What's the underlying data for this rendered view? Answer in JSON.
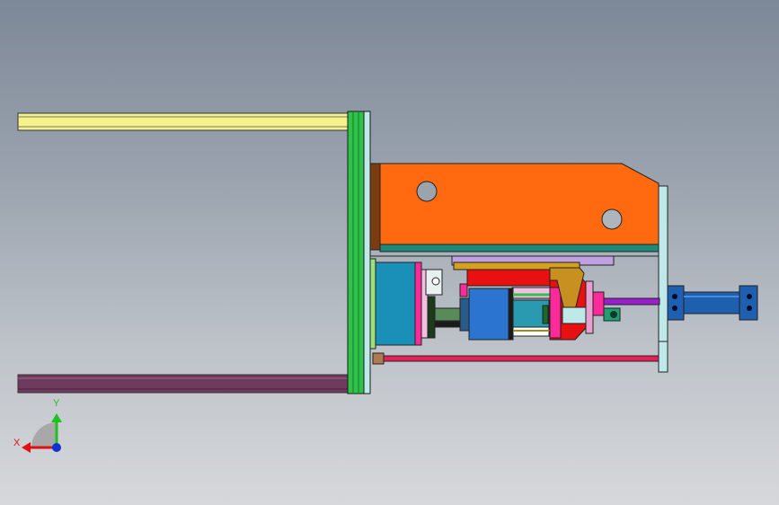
{
  "triad": {
    "x_label": "X",
    "y_label": "Y",
    "x_color": "#e01010",
    "y_color": "#20c020",
    "z_color": "#1030d0"
  },
  "colors": {
    "background_top": "#7d8898",
    "background_bottom": "#d6d8db",
    "upper_rail": "#f6f28a",
    "lower_rail": "#6e3a5e",
    "frame_plate": "#2ec24a",
    "bracket": "#ff6a10",
    "cylinder": "#1f5fb0",
    "piston_rod": "#9a1fcc",
    "tie_rod": "#e8205a",
    "end_plate": "#bfe8e8",
    "motor": "#1a90b8",
    "gear_block": "#2b74d0"
  }
}
